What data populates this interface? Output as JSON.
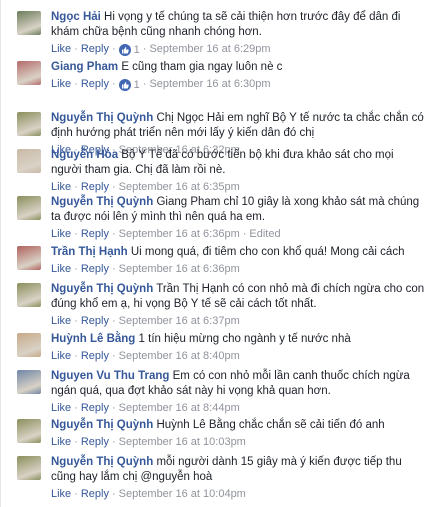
{
  "comments": [
    {
      "author": "Ngọc Hải",
      "text": "Hi vọng y tế chúng ta sẽ cải thiện hơn trước đây để dân đi khám chữa bệnh cũng nhanh chóng hơn.",
      "like": "Like",
      "reply": "Reply",
      "reactions": "1",
      "time": "September 16 at 6:29pm",
      "edited": "",
      "avatar_color": "#6b7d5a"
    },
    {
      "author": "Giang Pham",
      "text": "E cũng tham gia ngay luôn nè c",
      "like": "Like",
      "reply": "Reply",
      "reactions": "1",
      "time": "September 16 at 6:30pm",
      "edited": "",
      "avatar_color": "#b56b6b"
    },
    {
      "author": "Nguyễn Thị Quỳnh",
      "text": "Chị Ngọc Hải em nghĩ Bộ Y tế nước ta chắc chắn có định hướng phát triển nên mới lấy ý kiến dân đó chị",
      "like": "Like",
      "reply": "Reply",
      "reactions": "",
      "time": "September 16 at 6:32pm",
      "edited": "",
      "avatar_color": "#8a8f5c"
    },
    {
      "author": "Nguyễn Hòa",
      "text": "Bộ Y Tế đã có bước tiến bộ khi đưa khảo sát cho mọi người tham gia. Chị đã làm rồi nè.",
      "like": "Like",
      "reply": "Reply",
      "reactions": "",
      "time": "September 16 at 6:35pm",
      "edited": "",
      "avatar_color": "#c9b9a6"
    },
    {
      "author": "Nguyễn Thị Quỳnh",
      "text": "Giang Pham chỉ 10 giây là xong khảo sát mà chúng ta được nói lên ý mình thì nên quá ha em.",
      "like": "Like",
      "reply": "Reply",
      "reactions": "",
      "time": "September 16 at 6:36pm",
      "edited": "Edited",
      "avatar_color": "#8a8f5c"
    },
    {
      "author": "Trần Thị Hạnh",
      "text": "Ui mong quá, đi tiêm cho con khổ quá! Mong cải cách",
      "like": "Like",
      "reply": "Reply",
      "reactions": "",
      "time": "September 16 at 6:36pm",
      "edited": "",
      "avatar_color": "#b0625d"
    },
    {
      "author": "Nguyễn Thị Quỳnh",
      "text": "Trần Thị Hạnh có con nhỏ mà đi chích ngừa cho con đúng khổ em ạ, hi vọng Bộ Y tế sẽ cải cách tốt nhất.",
      "like": "Like",
      "reply": "Reply",
      "reactions": "",
      "time": "September 16 at 6:37pm",
      "edited": "",
      "avatar_color": "#8a8f5c"
    },
    {
      "author": "Huỳnh Lê Bằng",
      "text": "1 tín hiệu mừng cho ngành y tế nước nhà",
      "like": "Like",
      "reply": "Reply",
      "reactions": "",
      "time": "September 16 at 8:40pm",
      "edited": "",
      "avatar_color": "#c7a988"
    },
    {
      "author": "Nguyen Vu Thu Trang",
      "text": "Em có con nhỏ mỗi lần canh thuốc chích ngừa ngán quá, qua đợt khảo sát này hi vọng khả quan hơn.",
      "like": "Like",
      "reply": "Reply",
      "reactions": "",
      "time": "September 16 at 8:44pm",
      "edited": "",
      "avatar_color": "#6f86a6"
    },
    {
      "author": "Nguyễn Thị Quỳnh",
      "text": "Huỳnh Lê Bằng chắc chắn sẽ cải tiến đó anh",
      "like": "Like",
      "reply": "Reply",
      "reactions": "",
      "time": "September 16 at 10:03pm",
      "edited": "",
      "avatar_color": "#8a8f5c"
    },
    {
      "author": "Nguyễn Thị Quỳnh",
      "text": "mỗi người dành 15 giây mà ý kiến được tiếp thu cũng hay lắm chị @nguyễn hoà",
      "like": "Like",
      "reply": "Reply",
      "reactions": "",
      "time": "September 16 at 10:04pm",
      "edited": "",
      "avatar_color": "#8a8f5c"
    }
  ],
  "colors": {
    "link": "#365899",
    "meta": "#90949c",
    "like_badge": "#4267b2"
  }
}
